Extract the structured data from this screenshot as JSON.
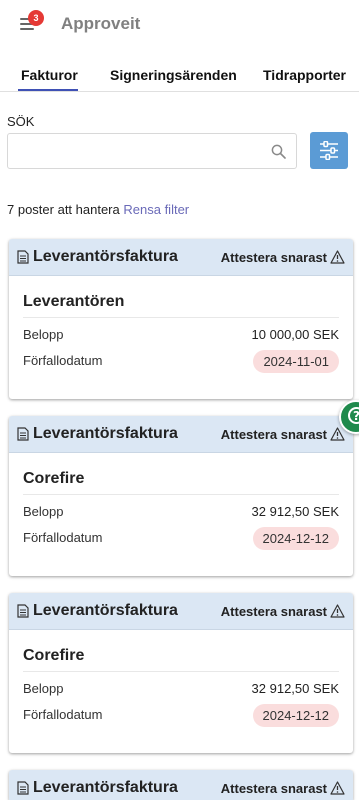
{
  "app": {
    "title": "Approveit",
    "notification_count": "3"
  },
  "tabs": [
    {
      "label": "Fakturor",
      "active": true
    },
    {
      "label": "Signeringsärenden",
      "active": false
    },
    {
      "label": "Tidrapporter",
      "active": false
    }
  ],
  "search": {
    "label": "SÖK",
    "value": "",
    "placeholder": ""
  },
  "results": {
    "count_text": "7 poster att hantera",
    "clear_filter_label": "Rensa filter"
  },
  "cards": [
    {
      "type": "Leverantörsfaktura",
      "status": "Attestera snarast",
      "supplier": "Leverantören",
      "amount_label": "Belopp",
      "amount": "10 000,00 SEK",
      "due_label": "Förfallodatum",
      "due_date": "2024-11-01"
    },
    {
      "type": "Leverantörsfaktura",
      "status": "Attestera snarast",
      "supplier": "Corefire",
      "amount_label": "Belopp",
      "amount": "32 912,50 SEK",
      "due_label": "Förfallodatum",
      "due_date": "2024-12-12"
    },
    {
      "type": "Leverantörsfaktura",
      "status": "Attestera snarast",
      "supplier": "Corefire",
      "amount_label": "Belopp",
      "amount": "32 912,50 SEK",
      "due_label": "Förfallodatum",
      "due_date": "2024-12-12"
    },
    {
      "type": "Leverantörsfaktura",
      "status": "Attestera snarast"
    }
  ],
  "help": {
    "icon": "question-icon",
    "glyph": "?"
  },
  "colors": {
    "accent": "#3f51b5",
    "filter_button": "#5b9bd5",
    "card_header": "#dbe7f4",
    "date_pill": "#fadddd",
    "badge": "#e53935",
    "help_button": "#1f8a4c"
  }
}
